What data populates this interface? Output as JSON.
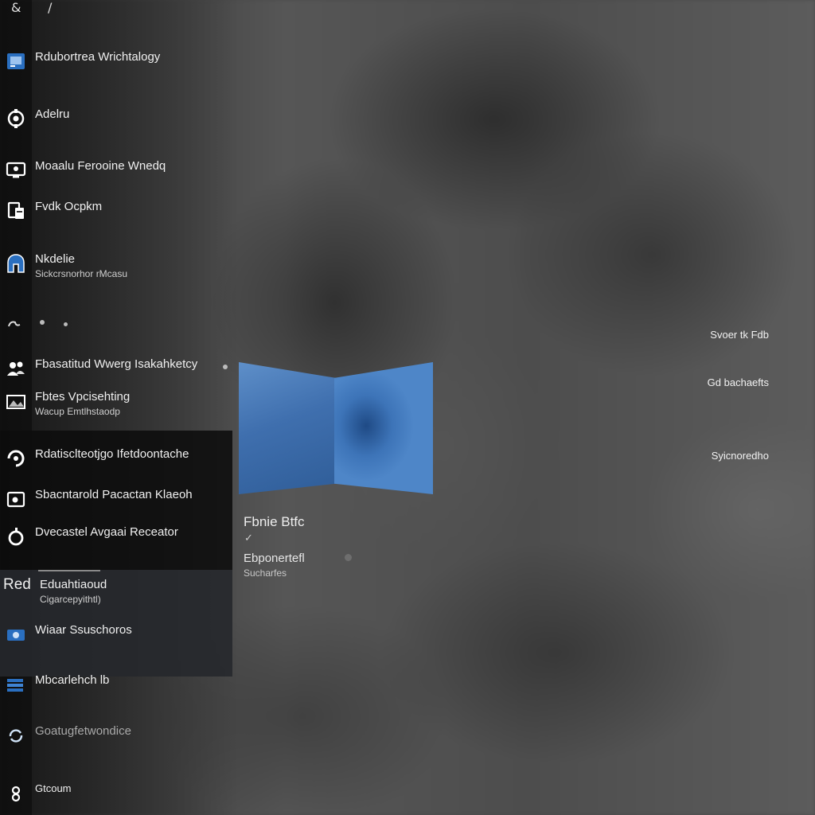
{
  "top": {
    "glyph_left": "&",
    "glyph_right": "/"
  },
  "sidebar": {
    "items": [
      {
        "label": "Rdubortrea Wrichtalogy",
        "icon": "app-window-icon",
        "accent": "#2a6fc0"
      },
      {
        "label": "Adelru",
        "icon": "gear-icon"
      },
      {
        "label": "Moaalu Ferooine Wnedq",
        "icon": "monitor-icon"
      },
      {
        "label": "Fvdk Ocpkm",
        "icon": "document-icon"
      },
      {
        "label": "Nkdelie",
        "sub": "Sickcrsnorhor rMcasu",
        "icon": "shield-icon",
        "accent": "#2a6fc0"
      },
      {
        "label": "",
        "icon": "cloud-icon"
      },
      {
        "label": "Fbasatitud Wwerg Isakahketcy",
        "icon": "people-icon"
      },
      {
        "label": "Fbtes Vpcisehting",
        "sub": "Wacup Emtlhstaodp",
        "icon": "image-icon"
      },
      {
        "label": "Rdatisclteotjgo Ifetdoontache",
        "icon": "refresh-icon"
      },
      {
        "label": "Sbacntarold Pacactan Klaeoh",
        "icon": "folder-icon"
      },
      {
        "label": "Dvecastel Avgaai Receator",
        "icon": "circle-icon"
      },
      {
        "label": "Eduahtiaoud",
        "sub": "Cigarcepyithtl)",
        "prefix": "Red",
        "icon": "text-icon"
      },
      {
        "label": "Wiaar Ssuschoros",
        "icon": "camera-icon",
        "accent": "#2a6fc0"
      },
      {
        "label": "Mbcarlehch lb",
        "icon": "stack-icon",
        "accent": "#2a6fc0"
      },
      {
        "label": "Goatugfetwondice",
        "icon": "sync-icon"
      },
      {
        "label": "Gtcoum",
        "icon": "user-icon"
      }
    ]
  },
  "center": {
    "title": "Fbnie Btfc",
    "check": "✓",
    "name": "Ebponertefl",
    "sub": "Sucharfes"
  },
  "right": {
    "items": [
      {
        "label": "Svoer tk Fdb"
      },
      {
        "label": "Gd bachaefts"
      },
      {
        "label": "Syicnoredho"
      }
    ]
  }
}
